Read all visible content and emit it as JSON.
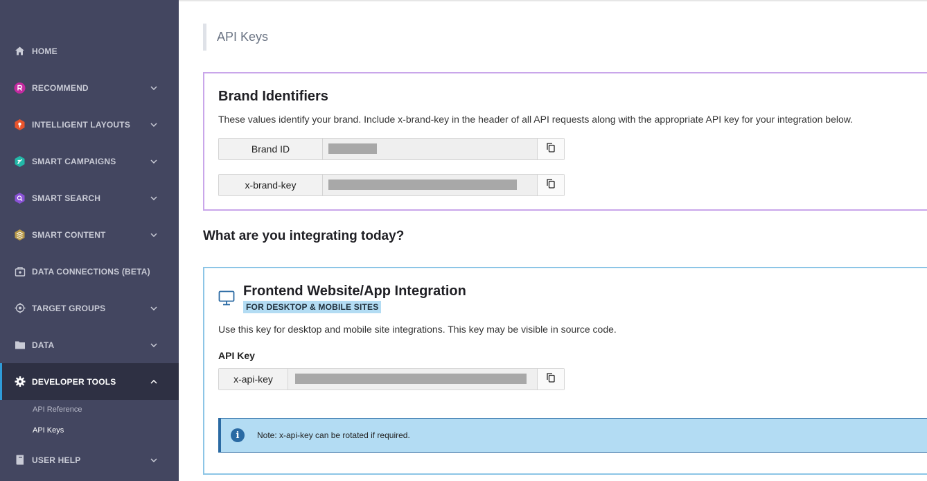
{
  "sidebar": {
    "items": [
      {
        "label": "HOME",
        "icon": "home-icon"
      },
      {
        "label": "RECOMMEND",
        "icon": "recommend-icon"
      },
      {
        "label": "INTELLIGENT LAYOUTS",
        "icon": "intelligent-layouts-icon"
      },
      {
        "label": "SMART CAMPAIGNS",
        "icon": "smart-campaigns-icon"
      },
      {
        "label": "SMART SEARCH",
        "icon": "smart-search-icon"
      },
      {
        "label": "SMART CONTENT",
        "icon": "smart-content-icon"
      },
      {
        "label": "DATA CONNECTIONS (BETA)",
        "icon": "data-connections-icon"
      },
      {
        "label": "TARGET GROUPS",
        "icon": "target-icon"
      },
      {
        "label": "DATA",
        "icon": "folder-icon"
      },
      {
        "label": "DEVELOPER TOOLS",
        "icon": "gear-icon"
      },
      {
        "label": "USER HELP",
        "icon": "book-icon"
      }
    ],
    "sub_items": [
      {
        "label": "API Reference"
      },
      {
        "label": "API Keys"
      }
    ]
  },
  "page": {
    "title": "API Keys"
  },
  "brand_card": {
    "title": "Brand Identifiers",
    "description": "These values identify your brand. Include x-brand-key in the header of all API requests along with the appropriate API key for your integration below.",
    "fields": [
      {
        "label": "Brand ID"
      },
      {
        "label": "x-brand-key"
      }
    ]
  },
  "integrating": {
    "heading": "What are you integrating today?"
  },
  "frontend_card": {
    "title": "Frontend Website/App Integration",
    "tag": "FOR DESKTOP & MOBILE SITES",
    "description": "Use this key for desktop and mobile site integrations. This key may be visible in source code.",
    "api_key_label": "API Key",
    "field_label": "x-api-key",
    "note": "Note: x-api-key can be rotated if required."
  },
  "colors": {
    "sidebar_bg": "#434660",
    "sidebar_active_bg": "#2e3043",
    "active_accent": "#2f9bd8",
    "brand_border": "#c9a6ea",
    "frontend_border": "#8cc5e6",
    "note_bg": "#b3dcf3"
  }
}
